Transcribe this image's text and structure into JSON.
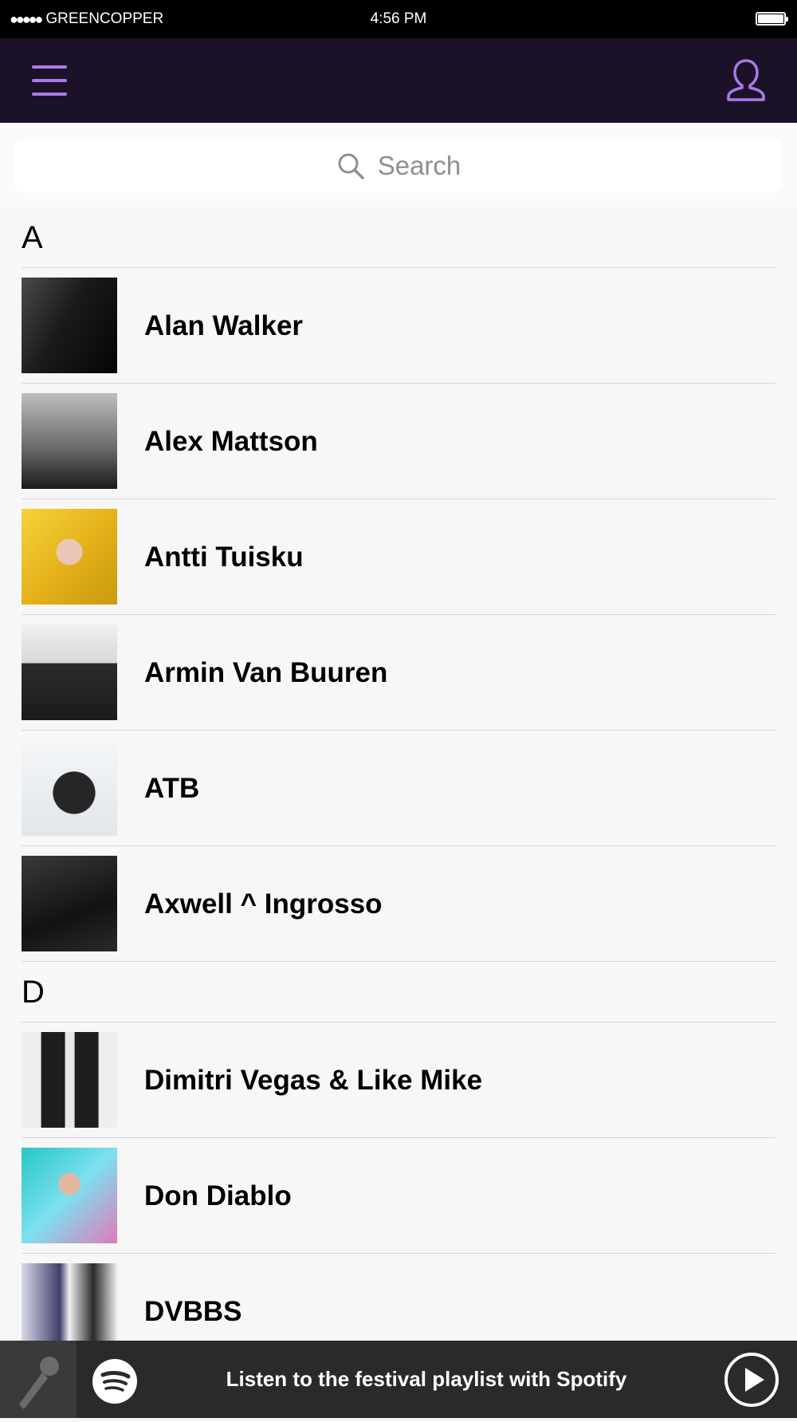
{
  "status_bar": {
    "signal_dots": "●●●●●",
    "carrier": "GREENCOPPER",
    "time": "4:56 PM"
  },
  "nav": {
    "menu_icon": "hamburger-icon",
    "profile_icon": "user-icon",
    "accent_color": "#a97ae8",
    "background_color": "#1c1228"
  },
  "search": {
    "placeholder": "Search",
    "icon": "search-icon"
  },
  "sections": [
    {
      "letter": "A",
      "artists": [
        {
          "name": "Alan Walker"
        },
        {
          "name": "Alex Mattson"
        },
        {
          "name": "Antti Tuisku"
        },
        {
          "name": "Armin Van Buuren"
        },
        {
          "name": "ATB"
        },
        {
          "name": "Axwell ^ Ingrosso"
        }
      ]
    },
    {
      "letter": "D",
      "artists": [
        {
          "name": "Dimitri Vegas & Like Mike"
        },
        {
          "name": "Don Diablo"
        },
        {
          "name": "DVBBS"
        }
      ]
    }
  ],
  "player": {
    "mic_icon": "microphone-icon",
    "spotify_icon": "spotify-icon",
    "label": "Listen to the festival playlist with Spotify",
    "play_icon": "play-icon"
  }
}
